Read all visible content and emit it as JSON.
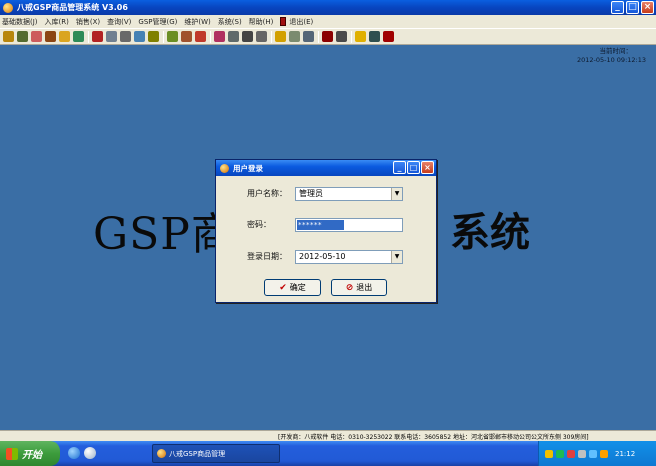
{
  "window": {
    "title": "八戒GSP商品管理系统 V3.06"
  },
  "menu": [
    "基础数据(J)",
    "入库(R)",
    "销售(X)",
    "查询(V)",
    "GSP管理(G)",
    "维护(W)",
    "系统(S)",
    "帮助(H)",
    "退出(E)"
  ],
  "clock": {
    "label": "当前时间：",
    "value": "2012-05-10 09:12:13"
  },
  "background_title": {
    "left": "GSP商",
    "right": "系统"
  },
  "dialog": {
    "title": "用户登录",
    "username_label": "用户名称：",
    "username_value": "管理员",
    "password_label": "密码：",
    "password_value": "******",
    "date_label": "登录日期：",
    "date_value": "2012-05-10",
    "ok_label": "确定",
    "exit_label": "退出"
  },
  "statusbar": {
    "text": "[开发商：八戒软件  电话：0310-3253022  联系电话：3605852  地址：河北省邯郸市移动公司公文所东侧  309房间]"
  },
  "taskbar": {
    "start_label": "开始",
    "task_label": "八戒GSP商品管理",
    "time": "21:12"
  }
}
